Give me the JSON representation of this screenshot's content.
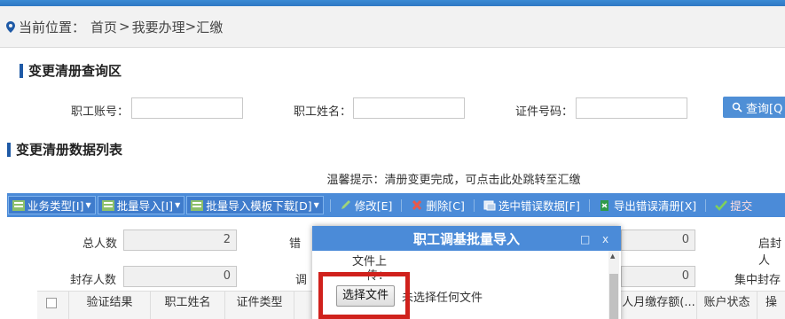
{
  "breadcrumb": {
    "label": "当前位置：",
    "home": "首页",
    "sep1": ">",
    "level1": "我要办理",
    "sep2": ">",
    "current": "汇缴"
  },
  "query_section": {
    "title": "变更清册查询区",
    "fields": [
      {
        "label": "职工账号：",
        "value": ""
      },
      {
        "label": "职工姓名：",
        "value": ""
      },
      {
        "label": "证件号码：",
        "value": ""
      }
    ],
    "query_button": "查询[Q"
  },
  "list_section": {
    "title": "变更清册数据列表",
    "tip": "温馨提示：清册变更完成，可点击此处跳转至汇缴"
  },
  "toolbar": [
    {
      "label": "业务类型[I]",
      "icon": "grid-icon",
      "dropdown": true
    },
    {
      "label": "批量导入[I]",
      "icon": "grid-icon",
      "dropdown": true
    },
    {
      "label": "批量导入模板下载[D]",
      "icon": "grid-icon",
      "dropdown": true
    },
    {
      "label": "修改[E]",
      "icon": "pencil-icon"
    },
    {
      "label": "删除[C]",
      "icon": "delete-x-icon"
    },
    {
      "label": "选中错误数据[F]",
      "icon": "select-icon"
    },
    {
      "label": "导出错误清册[X]",
      "icon": "export-icon"
    },
    {
      "label": "提交",
      "icon": "check-icon"
    }
  ],
  "stats": {
    "total_label": "总人数",
    "total_value": "2",
    "error_label": "错",
    "right1_value": "0",
    "start_seal_label": "启封人",
    "sealed_label": "封存人数",
    "sealed_value": "0",
    "adjust_label": "调",
    "right2_value": "0",
    "collect_seal_label": "集中封存人"
  },
  "table": {
    "headers": [
      "验证结果",
      "职工姓名",
      "证件类型",
      "人月缴存额(...",
      "账户状态",
      "操"
    ]
  },
  "modal": {
    "title": "职工调基批量导入",
    "min_icon": "□",
    "close_icon": "x",
    "file_label_line1": "文件上",
    "file_label_line2": "传：",
    "choose_button": "选择文件",
    "file_status": "未选择任何文件"
  },
  "colors": {
    "accent": "#4b8bd8",
    "highlight": "#d0211c",
    "title_bar": "#1f5aa6"
  }
}
